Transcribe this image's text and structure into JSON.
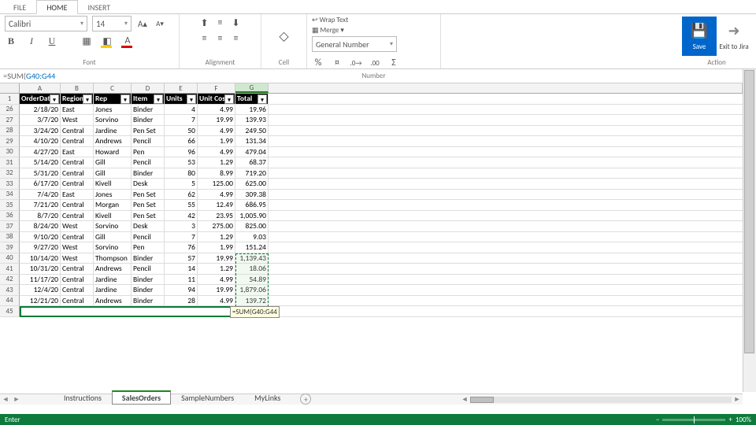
{
  "menu_tabs": {
    "file": "FILE",
    "home": "HOME",
    "insert": "INSERT"
  },
  "ribbon": {
    "font_name": "Calibri",
    "font_size": "14",
    "groups": {
      "font": "Font",
      "alignment": "Alignment",
      "cell": "Cell",
      "number": "Number",
      "action": "Action"
    },
    "wrap_text": "Wrap Text",
    "merge": "Merge",
    "number_format": "General Number",
    "save": "Save",
    "exit_jira": "Exit to Jira"
  },
  "formula": {
    "prefix": "=SUM(",
    "range": "G40:G44"
  },
  "columns": [
    "A",
    "B",
    "C",
    "D",
    "E",
    "F",
    "G"
  ],
  "headers": {
    "A": "OrderDate",
    "B": "Region",
    "C": "Rep",
    "D": "Item",
    "E": "Units",
    "F": "Unit Cost",
    "G": "Total"
  },
  "first_row_num": "1",
  "rows": [
    {
      "n": "26",
      "A": "2/18/20",
      "B": "East",
      "C": "Jones",
      "D": "Binder",
      "E": "4",
      "F": "4.99",
      "G": "19.96"
    },
    {
      "n": "27",
      "A": "3/7/20",
      "B": "West",
      "C": "Sorvino",
      "D": "Binder",
      "E": "7",
      "F": "19.99",
      "G": "139.93"
    },
    {
      "n": "28",
      "A": "3/24/20",
      "B": "Central",
      "C": "Jardine",
      "D": "Pen Set",
      "E": "50",
      "F": "4.99",
      "G": "249.50"
    },
    {
      "n": "29",
      "A": "4/10/20",
      "B": "Central",
      "C": "Andrews",
      "D": "Pencil",
      "E": "66",
      "F": "1.99",
      "G": "131.34"
    },
    {
      "n": "30",
      "A": "4/27/20",
      "B": "East",
      "C": "Howard",
      "D": "Pen",
      "E": "96",
      "F": "4.99",
      "G": "479.04"
    },
    {
      "n": "31",
      "A": "5/14/20",
      "B": "Central",
      "C": "Gill",
      "D": "Pencil",
      "E": "53",
      "F": "1.29",
      "G": "68.37"
    },
    {
      "n": "32",
      "A": "5/31/20",
      "B": "Central",
      "C": "Gill",
      "D": "Binder",
      "E": "80",
      "F": "8.99",
      "G": "719.20"
    },
    {
      "n": "33",
      "A": "6/17/20",
      "B": "Central",
      "C": "Kivell",
      "D": "Desk",
      "E": "5",
      "F": "125.00",
      "G": "625.00"
    },
    {
      "n": "34",
      "A": "7/4/20",
      "B": "East",
      "C": "Jones",
      "D": "Pen Set",
      "E": "62",
      "F": "4.99",
      "G": "309.38"
    },
    {
      "n": "35",
      "A": "7/21/20",
      "B": "Central",
      "C": "Morgan",
      "D": "Pen Set",
      "E": "55",
      "F": "12.49",
      "G": "686.95"
    },
    {
      "n": "36",
      "A": "8/7/20",
      "B": "Central",
      "C": "Kivell",
      "D": "Pen Set",
      "E": "42",
      "F": "23.95",
      "G": "1,005.90"
    },
    {
      "n": "37",
      "A": "8/24/20",
      "B": "West",
      "C": "Sorvino",
      "D": "Desk",
      "E": "3",
      "F": "275.00",
      "G": "825.00"
    },
    {
      "n": "38",
      "A": "9/10/20",
      "B": "Central",
      "C": "Gill",
      "D": "Pencil",
      "E": "7",
      "F": "1.29",
      "G": "9.03"
    },
    {
      "n": "39",
      "A": "9/27/20",
      "B": "West",
      "C": "Sorvino",
      "D": "Pen",
      "E": "76",
      "F": "1.99",
      "G": "151.24"
    },
    {
      "n": "40",
      "A": "10/14/20",
      "B": "West",
      "C": "Thompson",
      "D": "Binder",
      "E": "57",
      "F": "19.99",
      "G": "1,139.43"
    },
    {
      "n": "41",
      "A": "10/31/20",
      "B": "Central",
      "C": "Andrews",
      "D": "Pencil",
      "E": "14",
      "F": "1.29",
      "G": "18.06"
    },
    {
      "n": "42",
      "A": "11/17/20",
      "B": "Central",
      "C": "Jardine",
      "D": "Binder",
      "E": "11",
      "F": "4.99",
      "G": "54.89"
    },
    {
      "n": "43",
      "A": "12/4/20",
      "B": "Central",
      "C": "Jardine",
      "D": "Binder",
      "E": "94",
      "F": "19.99",
      "G": "1,879.06"
    },
    {
      "n": "44",
      "A": "12/21/20",
      "B": "Central",
      "C": "Andrews",
      "D": "Binder",
      "E": "28",
      "F": "4.99",
      "G": "139.72"
    }
  ],
  "editing_row": "45",
  "editing_tooltip": "=SUM(G40:G44",
  "sheets": {
    "s1": "Instructions",
    "s2": "SalesOrders",
    "s3": "SampleNumbers",
    "s4": "MyLinks"
  },
  "status": {
    "mode": "Enter",
    "zoom": "100%"
  }
}
